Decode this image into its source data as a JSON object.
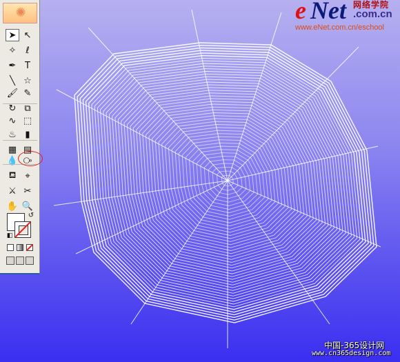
{
  "watermark": {
    "brand_e": "e",
    "brand_net": "Net",
    "chinese_name": "网络学院",
    "domain": ".com.cn",
    "url": "www.eNet.com.cn/eschool"
  },
  "footer": {
    "line1": "中国-365设计网",
    "line2": "www.cn365design.com"
  },
  "tools": [
    {
      "name": "selection-tool",
      "icon": "arrow-icon",
      "glyph": "➤",
      "active": true
    },
    {
      "name": "direct-selection-tool",
      "icon": "hollow-arrow-icon",
      "glyph": "↖"
    },
    {
      "name": "magic-wand-tool",
      "icon": "magic-wand-icon",
      "glyph": "✧"
    },
    {
      "name": "lasso-tool",
      "icon": "lasso-icon",
      "glyph": "ℓ"
    },
    {
      "name": "pen-tool",
      "icon": "pen-icon",
      "glyph": "✒"
    },
    {
      "name": "type-tool",
      "icon": "type-icon",
      "glyph": "T"
    },
    {
      "name": "line-tool",
      "icon": "line-segment-icon",
      "glyph": "╲"
    },
    {
      "name": "star-tool",
      "icon": "star-icon",
      "glyph": "☆"
    },
    {
      "name": "paintbrush-tool",
      "icon": "paintbrush-icon",
      "glyph": "🖌"
    },
    {
      "name": "pencil-tool",
      "icon": "pencil-icon",
      "glyph": "✎"
    },
    {
      "name": "rotate-tool",
      "icon": "rotate-icon",
      "glyph": "↻"
    },
    {
      "name": "scale-tool",
      "icon": "scale-icon",
      "glyph": "⧉"
    },
    {
      "name": "warp-tool",
      "icon": "warp-icon",
      "glyph": "∿"
    },
    {
      "name": "free-transform-tool",
      "icon": "free-transform-icon",
      "glyph": "⬚"
    },
    {
      "name": "symbol-sprayer-tool",
      "icon": "symbol-sprayer-icon",
      "glyph": "♨"
    },
    {
      "name": "column-graph-tool",
      "icon": "column-graph-icon",
      "glyph": "▮"
    },
    {
      "name": "mesh-tool",
      "icon": "mesh-icon",
      "glyph": "▦"
    },
    {
      "name": "gradient-tool",
      "icon": "gradient-icon",
      "glyph": "▤"
    },
    {
      "name": "eyedropper-tool",
      "icon": "eyedropper-icon",
      "glyph": "💧"
    },
    {
      "name": "blend-tool",
      "icon": "blend-icon",
      "glyph": "⧂"
    },
    {
      "name": "live-paint-bucket-tool",
      "icon": "paint-bucket-icon",
      "glyph": "⛾"
    },
    {
      "name": "live-paint-selection-tool",
      "icon": "live-paint-selection-icon",
      "glyph": "⌖"
    },
    {
      "name": "slice-tool",
      "icon": "slice-knife-icon",
      "glyph": "⚔"
    },
    {
      "name": "scissors-tool",
      "icon": "scissors-icon",
      "glyph": "✂"
    },
    {
      "name": "hand-tool",
      "icon": "hand-icon",
      "glyph": "✋"
    },
    {
      "name": "zoom-tool",
      "icon": "magnifier-icon",
      "glyph": "🔍"
    }
  ],
  "colors": {
    "canvas_top": "#b6b0f0",
    "canvas_bottom": "#3b2ff0",
    "web_stroke": "#ffffff",
    "highlight_circle": "#dd2222",
    "logo_red": "#e01010",
    "logo_blue": "#0c1a7a"
  }
}
